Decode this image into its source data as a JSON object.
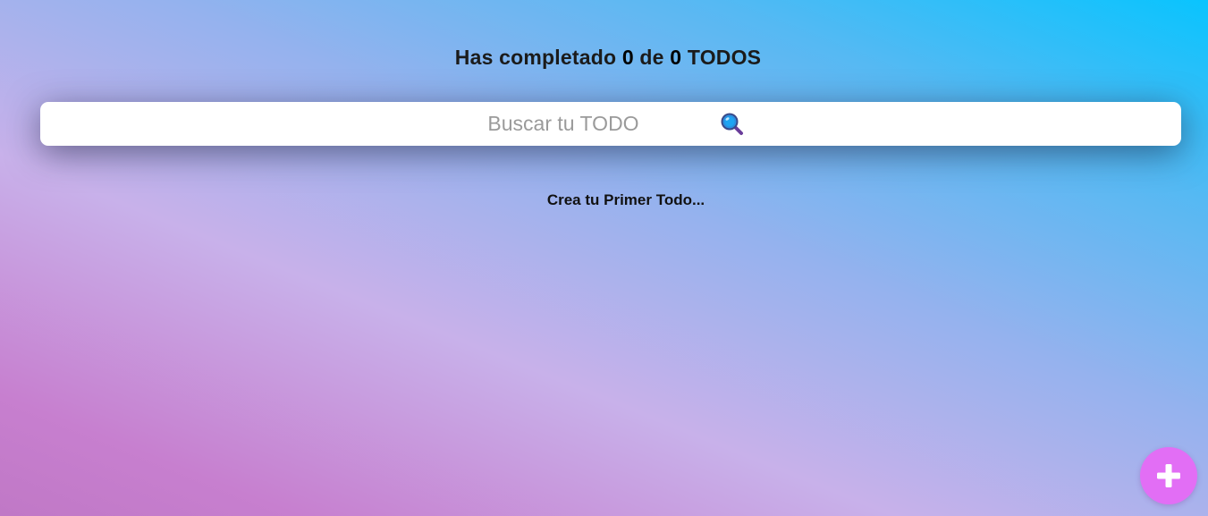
{
  "counter": {
    "prefix": "Has completado",
    "completed": "0",
    "middle": "de",
    "total": "0",
    "suffix": "TODOS"
  },
  "search": {
    "placeholder": "Buscar tu TODO",
    "value": "",
    "icon": "magnifying-glass-icon"
  },
  "empty_state": {
    "message": "Crea tu Primer Todo..."
  },
  "add_button": {
    "icon": "plus-icon",
    "color": "#e26ef5"
  },
  "colors": {
    "gradient_start": "#c078c6",
    "gradient_mid": "#c8b1ea",
    "gradient_end": "#09c4fe",
    "search_background": "#ffffff"
  }
}
